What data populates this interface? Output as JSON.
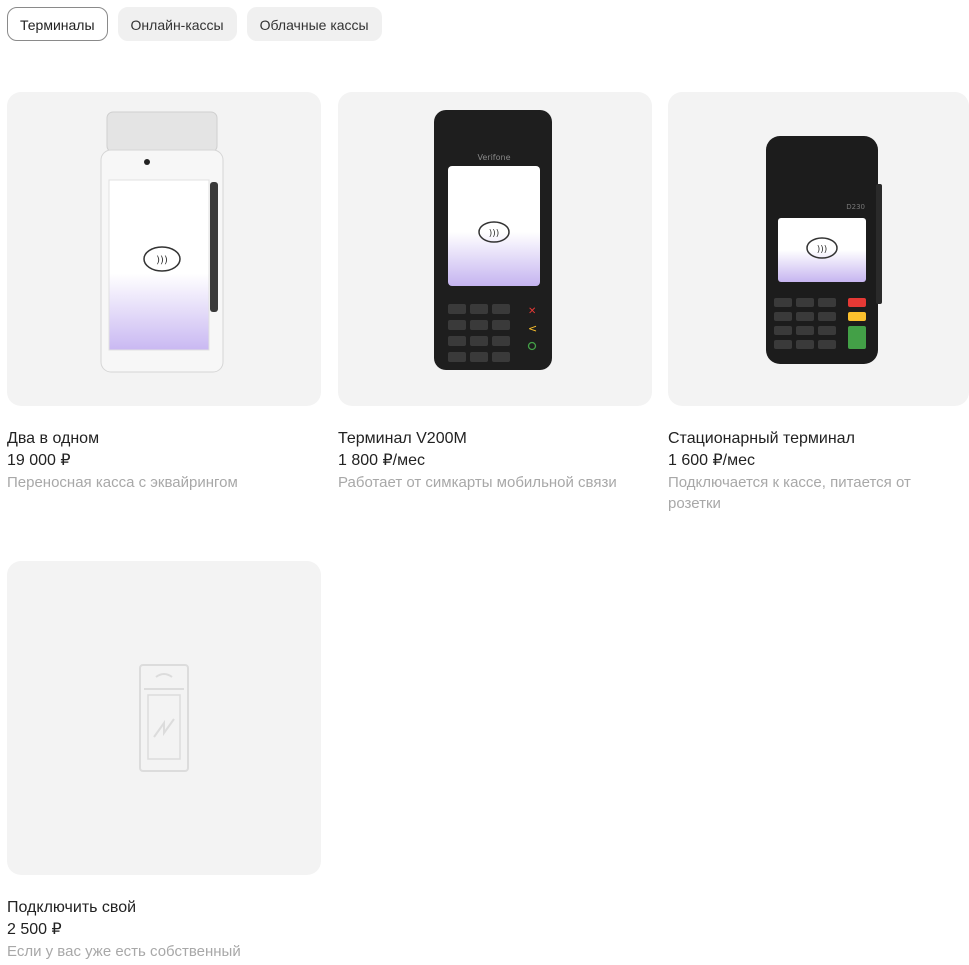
{
  "tabs": [
    {
      "label": "Терминалы",
      "active": true
    },
    {
      "label": "Онлайн-кассы",
      "active": false
    },
    {
      "label": "Облачные кассы",
      "active": false
    }
  ],
  "cards": [
    {
      "title": "Два в одном",
      "price": "19 000 ₽",
      "description": "Переносная касса с эквайрингом",
      "image": "smart-terminal-icon"
    },
    {
      "title": "Терминал V200M",
      "price": "1 800 ₽/мес",
      "description": "Работает от симкарты мобильной связи",
      "image": "mobile-terminal-icon",
      "brand": "Verifone"
    },
    {
      "title": "Стационарный терминал",
      "price": "1 600 ₽/мес",
      "description": "Подключается к кассе, питается от розетки",
      "image": "stationary-terminal-icon",
      "model": "D230"
    },
    {
      "title": "Подключить свой",
      "price": "2 500 ₽",
      "description": "Если у вас уже есть собственный",
      "image": "own-terminal-placeholder-icon"
    }
  ]
}
